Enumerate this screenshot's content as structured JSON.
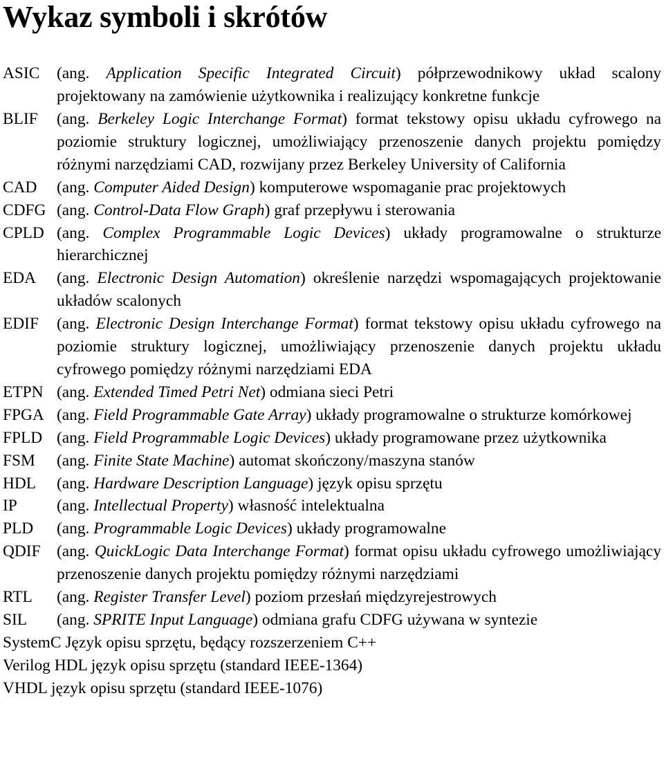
{
  "document": {
    "title": "Wykaz symboli i skrótów",
    "language_tag": "ang.",
    "background_color": "#ffffff",
    "text_color": "#000000"
  },
  "entries": [
    {
      "term": "ASIC",
      "open_paren": "(ang. ",
      "english": "Application Specific Integrated Circuit",
      "close_paren": ") ",
      "polish": "półprzewodnikowy układ scalony projektowany na zamówienie użytkownika i realizujący konkretne funkcje",
      "inline": false
    },
    {
      "term": "BLIF",
      "open_paren": "(ang. ",
      "english": "Berkeley Logic Interchange Format",
      "close_paren": ") ",
      "polish": "format tekstowy opisu układu cyfrowego na poziomie struktury logicznej, umożliwiający przenoszenie danych projektu pomiędzy różnymi narzędziami CAD, rozwijany przez Berkeley University of California",
      "inline": false
    },
    {
      "term": "CAD",
      "open_paren": "(ang. ",
      "english": "Computer Aided Design",
      "close_paren": ") ",
      "polish": "komputerowe wspomaganie prac projektowych",
      "inline": false
    },
    {
      "term": "CDFG",
      "open_paren": "(ang. ",
      "english": "Control-Data Flow Graph",
      "close_paren": ") ",
      "polish": "graf przepływu i sterowania",
      "inline": false
    },
    {
      "term": "CPLD",
      "open_paren": "(ang. ",
      "english": "Complex Programmable Logic Devices",
      "close_paren": ") ",
      "polish": "układy programowalne o strukturze hierarchicznej",
      "inline": false
    },
    {
      "term": "EDA",
      "open_paren": "(ang. ",
      "english": "Electronic Design Automation",
      "close_paren": ") ",
      "polish": "określenie narzędzi wspomagających projektowanie układów scalonych",
      "inline": false
    },
    {
      "term": "EDIF",
      "open_paren": "(ang. ",
      "english": "Electronic Design Interchange Format",
      "close_paren": ") ",
      "polish": "format tekstowy opisu układu cyfrowego na poziomie struktury logicznej, umożliwiający przenoszenie danych projektu układu cyfrowego pomiędzy różnymi narzędziami EDA",
      "inline": false
    },
    {
      "term": "ETPN",
      "open_paren": "(ang. ",
      "english": "Extended Timed Petri Net",
      "close_paren": ") ",
      "polish": "odmiana sieci Petri",
      "inline": false
    },
    {
      "term": "FPGA",
      "open_paren": "(ang. ",
      "english": "Field Programmable Gate Array",
      "close_paren": ") ",
      "polish": "układy programowalne o strukturze komórkowej",
      "inline": false
    },
    {
      "term": "FPLD",
      "open_paren": "(ang. ",
      "english": "Field Programmable Logic Devices",
      "close_paren": ") ",
      "polish": "układy programowane przez użytkownika",
      "inline": false
    },
    {
      "term": "FSM",
      "open_paren": "(ang. ",
      "english": "Finite State Machine",
      "close_paren": ") ",
      "polish": "automat skończony/maszyna stanów",
      "inline": false
    },
    {
      "term": "HDL",
      "open_paren": "(ang. ",
      "english": "Hardware Description Language",
      "close_paren": ") ",
      "polish": "język opisu sprzętu",
      "inline": false
    },
    {
      "term": "IP",
      "open_paren": "(ang. ",
      "english": "Intellectual Property",
      "close_paren": ") ",
      "polish": "własność intelektualna",
      "inline": false
    },
    {
      "term": "PLD",
      "open_paren": "(ang. ",
      "english": "Programmable Logic Devices",
      "close_paren": ") ",
      "polish": "układy programowalne",
      "inline": false
    },
    {
      "term": "QDIF",
      "open_paren": "(ang. ",
      "english": "QuickLogic Data Interchange Format",
      "close_paren": ") ",
      "polish": "format opisu układu cyfrowego umożliwiający przenoszenie danych projektu pomiędzy różnymi narzędziami",
      "inline": false
    },
    {
      "term": "RTL",
      "open_paren": "(ang. ",
      "english": "Register Transfer Level",
      "close_paren": ") ",
      "polish": "poziom przesłań międzyrejestrowych",
      "inline": false
    },
    {
      "term": "SIL",
      "open_paren": "(ang. ",
      "english": "SPRITE Input Language",
      "close_paren": ") ",
      "polish": "odmiana grafu CDFG używana w syntezie",
      "inline": false
    },
    {
      "term": "SystemC",
      "open_paren": "",
      "english": "",
      "close_paren": "",
      "polish": " Język opisu sprzętu, będący rozszerzeniem C++",
      "inline": true
    },
    {
      "term": "Verilog HDL",
      "open_paren": "",
      "english": "",
      "close_paren": "",
      "polish": " język opisu sprzętu (standard IEEE-1364)",
      "inline": true
    },
    {
      "term": "VHDL",
      "open_paren": "",
      "english": "",
      "close_paren": "",
      "polish": " język opisu sprzętu (standard IEEE-1076)",
      "inline": true
    }
  ]
}
